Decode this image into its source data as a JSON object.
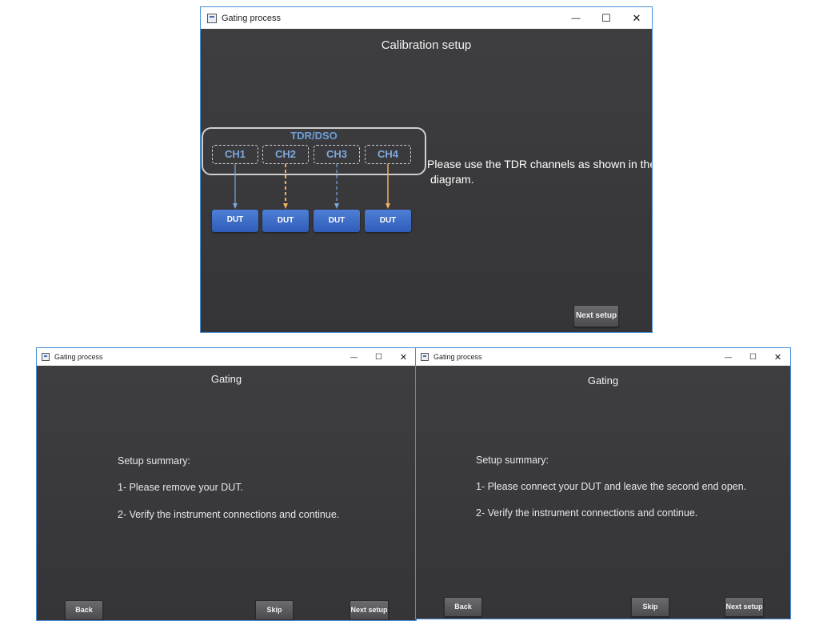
{
  "window_title": "Gating process",
  "controls": {
    "minimize": "—",
    "maximize": "☐",
    "close": "✕"
  },
  "calibration": {
    "heading": "Calibration setup",
    "diagram_title": "TDR/DSO",
    "channels": [
      "CH1",
      "CH2",
      "CH3",
      "CH4"
    ],
    "dut_label": "DUT",
    "instruction_line1": "Please use the TDR channels as shown in the",
    "instruction_line2": "diagram.",
    "next_label": "Next setup",
    "arrow_colors": [
      "#7aa7d9",
      "#f0b060",
      "#7aa7d9",
      "#f0b060"
    ]
  },
  "gating_a": {
    "heading": "Gating",
    "summary_title": "Setup summary:",
    "step1": "1- Please remove your DUT.",
    "step2": "2- Verify the instrument connections and continue.",
    "back_label": "Back",
    "skip_label": "Skip",
    "next_label": "Next setup"
  },
  "gating_b": {
    "heading": "Gating",
    "summary_title": "Setup summary:",
    "step1": "1- Please connect your DUT and leave the second end open.",
    "step2": "2- Verify the instrument connections and continue.",
    "back_label": "Back",
    "skip_label": "Skip",
    "next_label": "Next setup"
  }
}
